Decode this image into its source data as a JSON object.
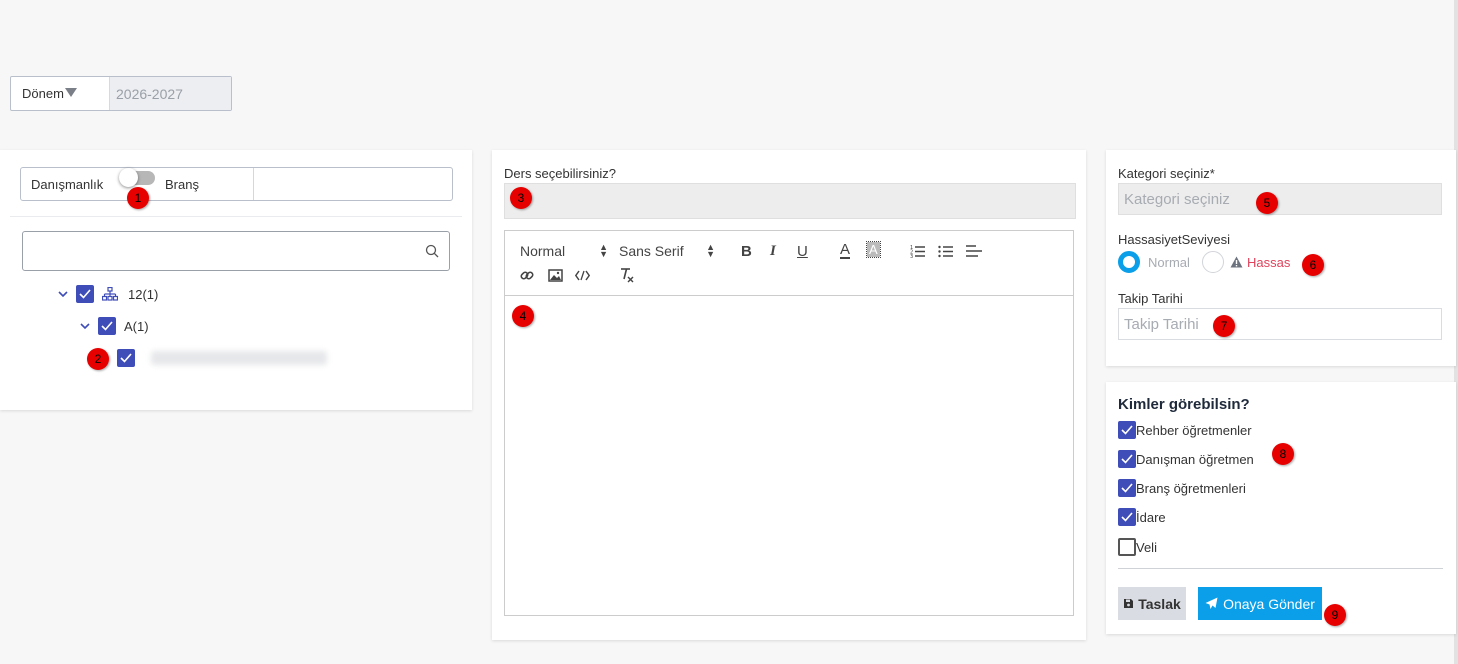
{
  "period": {
    "label": "Dönem",
    "value": "2026-2027"
  },
  "left": {
    "toggle_left": "Danışmanlık",
    "toggle_right": "Branş",
    "search_placeholder": "",
    "tree": [
      {
        "label": "12(1)",
        "checked": true
      },
      {
        "label": "A(1)",
        "checked": true
      },
      {
        "label": "",
        "checked": true
      }
    ]
  },
  "middle": {
    "course_label": "Ders seçebilirsiniz?",
    "editor": {
      "format": "Normal",
      "font": "Sans Serif",
      "bold": "B",
      "italic": "I",
      "underline": "U",
      "color": "A",
      "background": "A"
    }
  },
  "right": {
    "category_label": "Kategori seçiniz*",
    "category_placeholder": "Kategori seçiniz",
    "sensitivity_label": "HassasiyetSeviyesi",
    "sensitivity_options": [
      "Normal",
      "Hassas"
    ],
    "followup_label": "Takip Tarihi",
    "followup_placeholder": "Takip Tarihi",
    "visibility_title": "Kimler görebilsin?",
    "visibility": [
      {
        "label": "Rehber öğretmenler",
        "checked": true
      },
      {
        "label": "Danışman öğretmen",
        "checked": true
      },
      {
        "label": "Branş öğretmenleri",
        "checked": true
      },
      {
        "label": "İdare",
        "checked": true
      },
      {
        "label": "Veli",
        "checked": false
      }
    ],
    "draft_button": "Taslak",
    "send_button": "Onaya Gönder"
  },
  "markers": [
    "1",
    "2",
    "3",
    "4",
    "5",
    "6",
    "7",
    "8",
    "9"
  ],
  "colors": {
    "accent": "#0a9fe8",
    "checkbox": "#3f4db8",
    "danger": "#e0435c",
    "marker": "#e60000"
  }
}
